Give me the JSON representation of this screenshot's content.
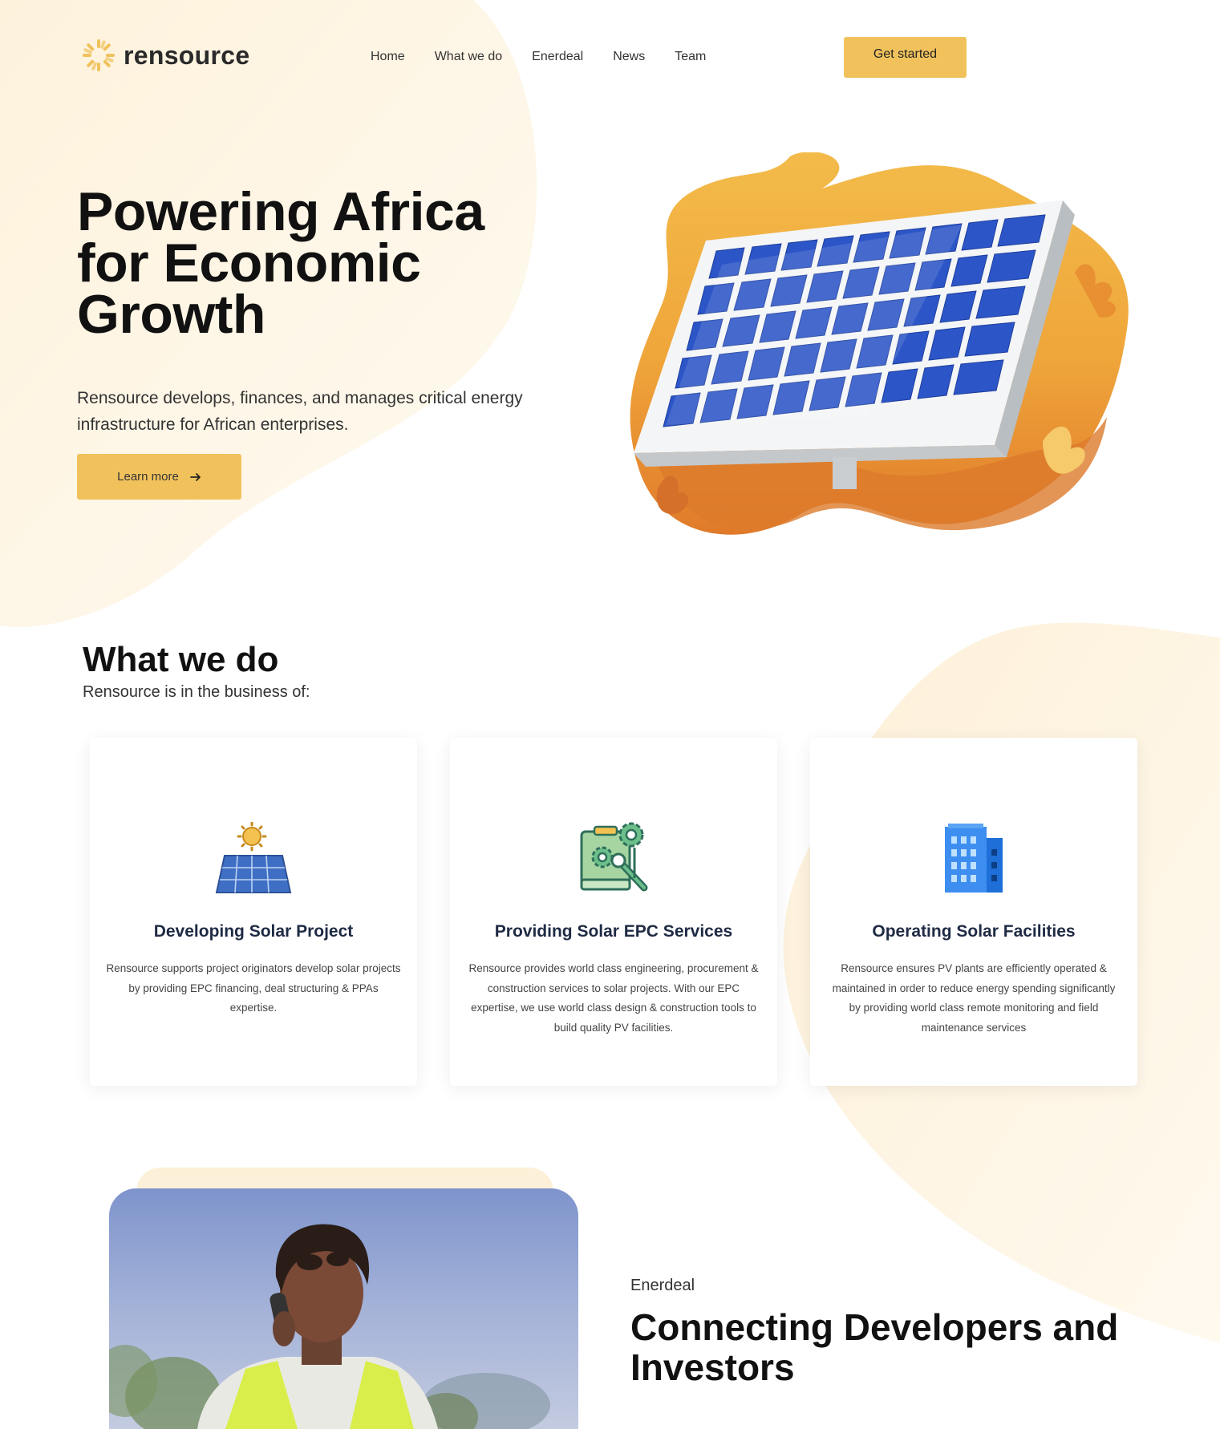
{
  "brand": {
    "name": "rensource",
    "accent": "#f1c25c"
  },
  "nav": {
    "items": [
      "Home",
      "What we do",
      "Enerdeal",
      "News",
      "Team"
    ],
    "cta": "Get started"
  },
  "hero": {
    "title": "Powering Africa for Economic Growth",
    "subtitle": "Rensource develops, finances, and manages critical energy infrastructure for African enterprises.",
    "button": "Learn more",
    "button_icon": "arrow-right-icon"
  },
  "what_we_do": {
    "title": "What we do",
    "subtitle": "Rensource is in the business of:",
    "cards": [
      {
        "icon": "solar-panel-sun-icon",
        "title": "Developing Solar Project",
        "text": "Rensource supports project originators develop solar projects by providing EPC financing, deal structuring & PPAs expertise."
      },
      {
        "icon": "engineering-gears-icon",
        "title": "Providing Solar EPC Services",
        "text": "Rensource provides world class engineering, procurement & construction services to solar projects. With our EPC expertise, we use world class design & construction tools to build quality PV facilities."
      },
      {
        "icon": "office-building-icon",
        "title": "Operating Solar Facilities",
        "text": "Rensource ensures PV plants are efficiently operated & maintained in order to reduce energy spending significantly by providing world class remote monitoring and field maintenance services"
      }
    ]
  },
  "enerdeal": {
    "tag": "Enerdeal",
    "title": "Connecting Developers and Investors"
  }
}
